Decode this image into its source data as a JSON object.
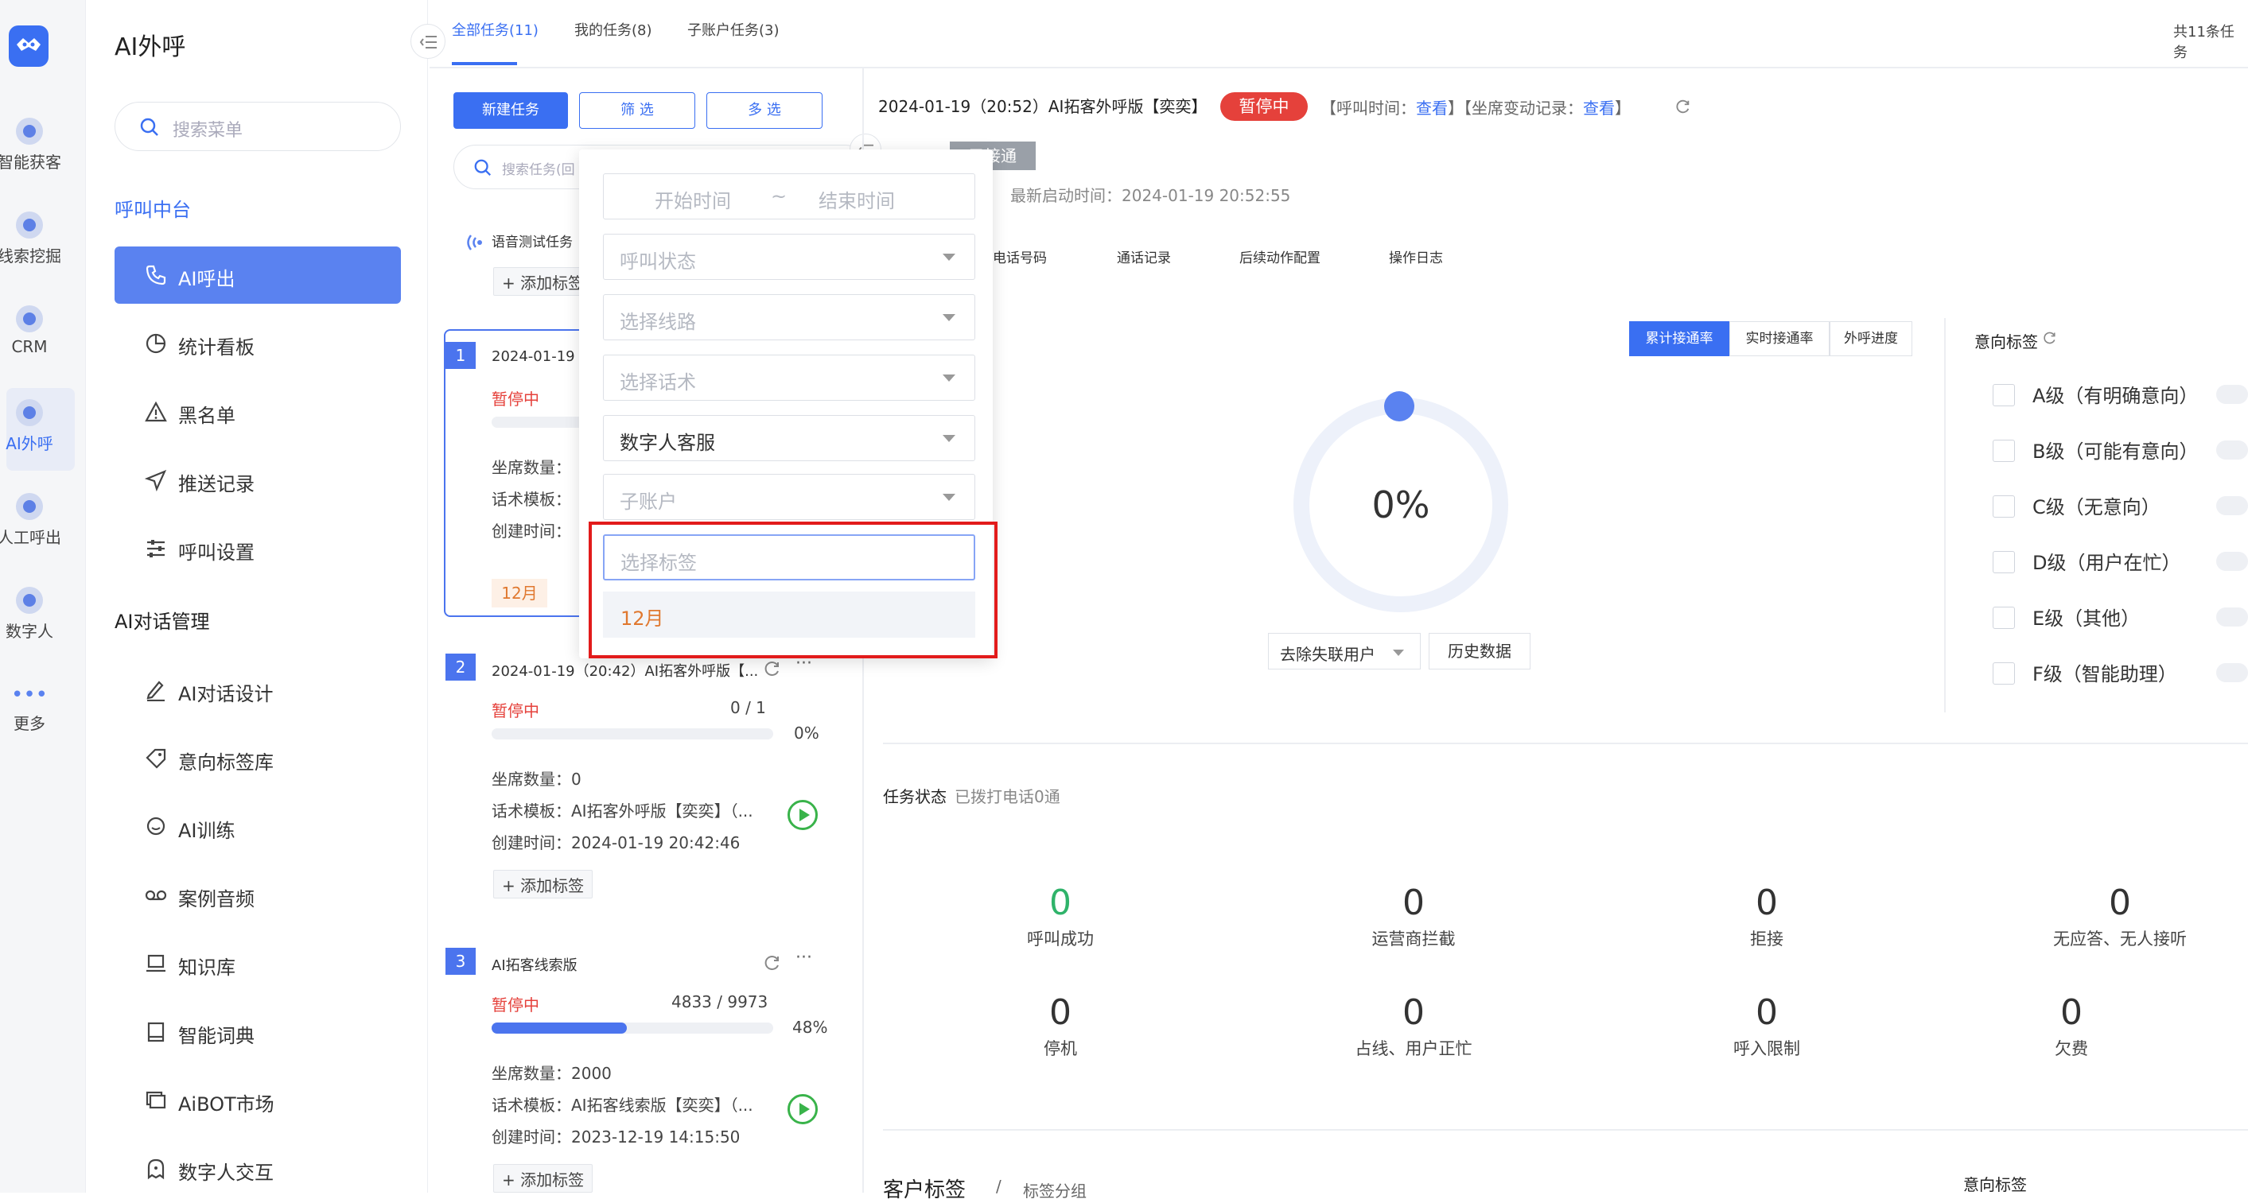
{
  "rail": {
    "items": [
      {
        "label": "智能获客",
        "icon": "target-icon"
      },
      {
        "label": "线索挖掘",
        "icon": "clue-icon"
      },
      {
        "label": "CRM",
        "icon": "crm-icon"
      },
      {
        "label": "AI外呼",
        "icon": "robot-icon"
      },
      {
        "label": "人工呼出",
        "icon": "headset-icon"
      },
      {
        "label": "数字人",
        "icon": "digital-human-icon"
      },
      {
        "label": "更多",
        "icon": "more-icon"
      }
    ]
  },
  "sidebar": {
    "title": "AI外呼",
    "search_placeholder": "搜索菜单",
    "section_call": "呼叫中台",
    "section_dialog": "AI对话管理",
    "call_items": [
      {
        "label": "AI呼出",
        "icon": "phone-icon"
      },
      {
        "label": "统计看板",
        "icon": "pie-chart-icon"
      },
      {
        "label": "黑名单",
        "icon": "warning-icon"
      },
      {
        "label": "推送记录",
        "icon": "send-icon"
      },
      {
        "label": "呼叫设置",
        "icon": "sliders-icon"
      }
    ],
    "dialog_items": [
      {
        "label": "AI对话设计",
        "icon": "pen-icon"
      },
      {
        "label": "意向标签库",
        "icon": "tag-icon"
      },
      {
        "label": "AI训练",
        "icon": "chat-icon"
      },
      {
        "label": "案例音频",
        "icon": "tape-icon"
      },
      {
        "label": "知识库",
        "icon": "laptop-icon"
      },
      {
        "label": "智能词典",
        "icon": "book-icon"
      },
      {
        "label": "AiBOT市场",
        "icon": "market-icon"
      },
      {
        "label": "数字人交互",
        "icon": "ghost-icon"
      }
    ]
  },
  "tabs": {
    "all": "全部任务(11)",
    "mine": "我的任务(8)",
    "sub": "子账户任务(3)"
  },
  "total": "共11条任务",
  "toolbar": {
    "new": "新建任务",
    "filter": "筛 选",
    "multi": "多 选"
  },
  "task_search_placeholder": "搜索任务(回",
  "group_label": "语音测试任务",
  "add_tag": "+ 添加标签",
  "tasks": [
    {
      "no": "1",
      "title": "2024-01-19",
      "status": "暂停中",
      "seats": "坐席数量：",
      "tpl": "话术模板：",
      "created": "创建时间：",
      "tag": "12月"
    },
    {
      "no": "2",
      "title": "2024-01-19（20:42）AI拓客外呼版【...",
      "status": "暂停中",
      "count": "0 / 1",
      "pct": "0%",
      "progress": 0,
      "seats": "坐席数量：0",
      "tpl": "话术模板：AI拓客外呼版【奕奕】（...",
      "created": "创建时间：2024-01-19 20:42:46"
    },
    {
      "no": "3",
      "title": "AI拓客线索版",
      "status": "暂停中",
      "count": "4833 / 9973",
      "pct": "48%",
      "progress": 0.48,
      "seats": "坐席数量：2000",
      "tpl": "话术模板：AI拓客线索版【奕奕】（...",
      "created": "创建时间：2023-12-19 14:15:50"
    }
  ],
  "filter": {
    "start": "开始时间",
    "tilde": "~",
    "end": "结束时间",
    "call_status": "呼叫状态",
    "line": "选择线路",
    "script": "选择话术",
    "selected_role": "数字人客服",
    "sub_account": "子账户",
    "tag_placeholder": "选择标签",
    "tag_option": "12月"
  },
  "detail": {
    "title": "2024-01-19（20:52）AI拓客外呼版【奕奕】",
    "status": "暂停中",
    "call_time_label": "【呼叫时间：",
    "call_time_link": "查看",
    "seat_change_label": "】【坐席变动记录：",
    "seat_change_link": "查看",
    "bracket_end": "】",
    "badge_partial": "已接通",
    "last_start": "最新启动时间：2024-01-19 20:52:55",
    "tabs": [
      "电话号码",
      "通话记录",
      "后续动作配置",
      "操作日志"
    ],
    "chips": [
      "累计接通率",
      "实时接通率",
      "外呼进度"
    ],
    "donut_value": "0%",
    "donut_progress": 0,
    "exclude_label": "去除失联用户",
    "history": "历史数据",
    "intent_title": "意向标签",
    "intents": [
      "A级（有明确意向）",
      "B级（可能有意向）",
      "C级（无意向）",
      "D级（用户在忙）",
      "E级（其他）",
      "F级（智能助理）"
    ],
    "task_status_label": "任务状态",
    "task_status_sub": "已拨打电话0通",
    "stats": [
      {
        "n": "0",
        "l": "呼叫成功"
      },
      {
        "n": "0",
        "l": "运营商拦截"
      },
      {
        "n": "0",
        "l": "拒接"
      },
      {
        "n": "0",
        "l": "无应答、无人接听"
      },
      {
        "n": "0",
        "l": "停机"
      },
      {
        "n": "0",
        "l": "占线、用户正忙"
      },
      {
        "n": "0",
        "l": "呼入限制"
      },
      {
        "n": "0",
        "l": "欠费"
      }
    ],
    "bottom_left": "客户标签",
    "bottom_sep": "/",
    "bottom_mid": "标签分组",
    "bottom_right": "意向标签"
  },
  "colors": {
    "accent": "#3a6ff2",
    "danger": "#e5413b",
    "success": "#2fb36a",
    "highlight": "#e21b1b",
    "tag": "#e0782f"
  }
}
